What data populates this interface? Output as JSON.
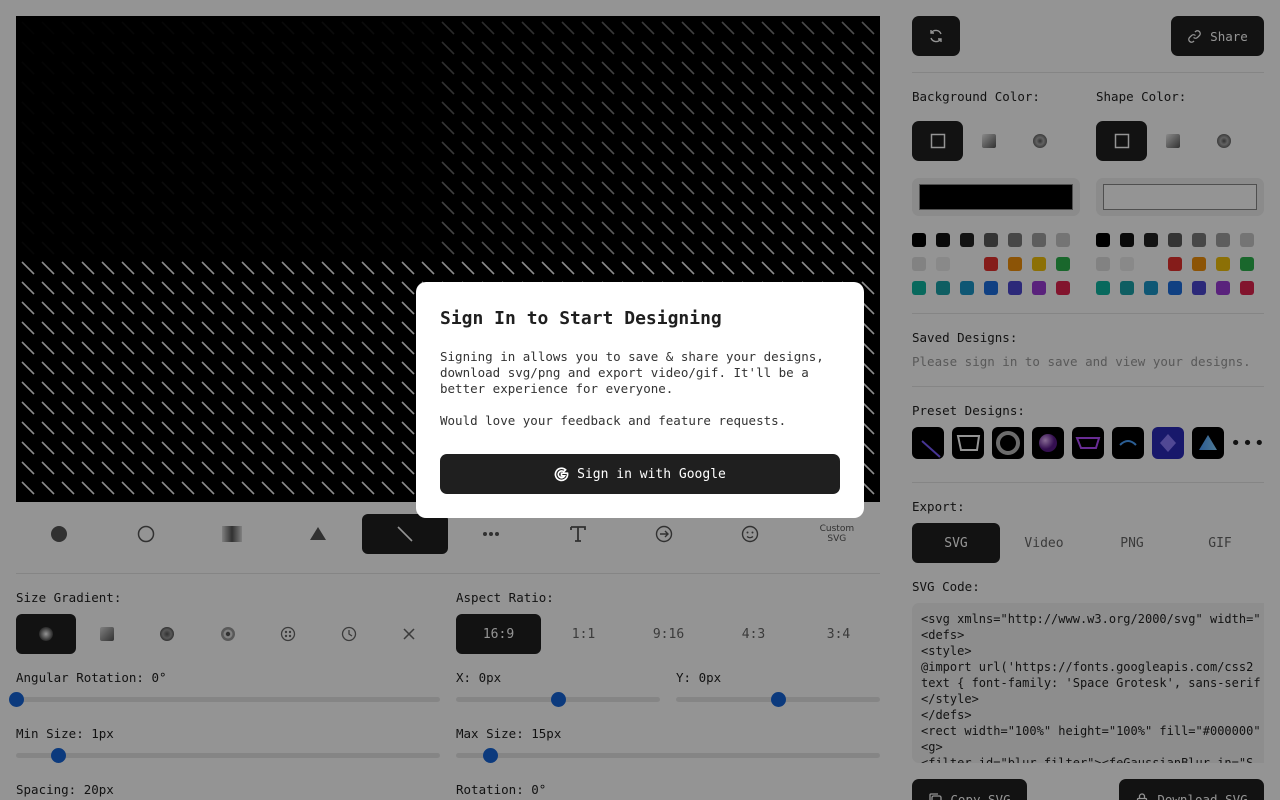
{
  "canvas": {
    "background": "#000000",
    "shape_color": "#ffffff"
  },
  "shape_toolbar": {
    "items": [
      "filled-circle",
      "outline-circle",
      "gradient-square",
      "triangle",
      "line",
      "dots",
      "text",
      "arrow-circle",
      "smiley"
    ],
    "active_index": 4,
    "custom_label_1": "Custom",
    "custom_label_2": "SVG"
  },
  "size_gradient": {
    "label": "Size Gradient:",
    "options": [
      "radial-dark",
      "square-gradient",
      "radial",
      "ring",
      "dots-circle",
      "clock",
      "none"
    ],
    "active_index": 0
  },
  "aspect_ratio": {
    "label": "Aspect Ratio:",
    "options": [
      "16:9",
      "1:1",
      "9:16",
      "4:3",
      "3:4"
    ],
    "active_index": 0
  },
  "sliders": {
    "angular_rotation": {
      "label": "Angular Rotation: 0°",
      "value_fraction": 0.0
    },
    "x": {
      "label": "X: 0px",
      "value_fraction": 0.5
    },
    "y": {
      "label": "Y: 0px",
      "value_fraction": 0.5
    },
    "min_size": {
      "label": "Min Size: 1px",
      "value_fraction": 0.1
    },
    "max_size": {
      "label": "Max Size: 15px",
      "value_fraction": 0.08
    },
    "spacing": {
      "label": "Spacing: 20px"
    },
    "rotation": {
      "label": "Rotation: 0°"
    }
  },
  "header": {
    "share_label": "Share"
  },
  "background_color": {
    "label": "Background Color:",
    "value": "#000000",
    "mode_active": 0
  },
  "shape_color": {
    "label": "Shape Color:",
    "value": "#ffffff",
    "mode_active": 0
  },
  "palette": [
    "#000000",
    "#111111",
    "#222222",
    "#5a5a5a",
    "#7a7a7a",
    "#a0a0a0",
    "#c8c8c8",
    "#e0e0e0",
    "#ededed",
    "#ffffff",
    "#e5312d",
    "#f2920c",
    "#f2c10c",
    "#2bb24c",
    "#0fb5a1",
    "#1aa3a9",
    "#1b97c9",
    "#1c6fe0",
    "#4c47d1",
    "#9b3bd6",
    "#e0244e"
  ],
  "saved_designs": {
    "label": "Saved Designs:",
    "message": "Please sign in to save and view your designs."
  },
  "preset_designs": {
    "label": "Preset Designs:",
    "more": "•••"
  },
  "export": {
    "label": "Export:",
    "tabs": [
      "SVG",
      "Video",
      "PNG",
      "GIF"
    ],
    "active_index": 0
  },
  "svg_code": {
    "label": "SVG Code:",
    "lines": [
      "<svg xmlns=\"http://www.w3.org/2000/svg\" width=\"",
      "<defs>",
      "<style>",
      "@import url('https://fonts.googleapis.com/css2",
      "text { font-family: 'Space Grotesk', sans-serif",
      "</style>",
      "</defs>",
      "<rect width=\"100%\" height=\"100%\" fill=\"#000000\"",
      "<g>",
      "<filter id=\"blur-filter\"><feGaussianBlur in=\"S"
    ]
  },
  "bottom_buttons": {
    "copy": "Copy SVG",
    "download": "Download SVG"
  },
  "modal": {
    "title": "Sign In to Start Designing",
    "body1": "Signing in allows you to save & share your designs, download svg/png and export video/gif. It'll be a better experience for everyone.",
    "body2": "Would love your feedback and feature requests.",
    "google_button": "Sign in with Google"
  }
}
